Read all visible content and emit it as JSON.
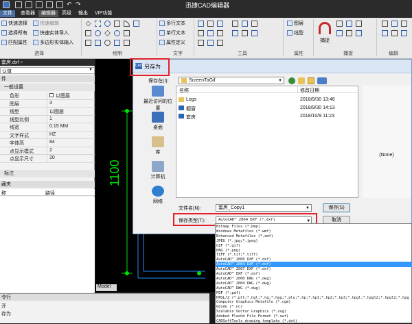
{
  "app": {
    "title": "迅捷CAD编辑器",
    "menu": [
      "文件",
      "查看器",
      "编辑器",
      "高级",
      "输出",
      "VIP功能"
    ],
    "active_menu": "编辑器",
    "accent": "#4a6fa5"
  },
  "ribbon": {
    "select_group": {
      "items": [
        "快速选择",
        "选择所有",
        "匹配属性",
        "快速编辑",
        "快速实体导入",
        "多边形实体输入"
      ],
      "label": "选择"
    },
    "draw_group": {
      "label": "绘制"
    },
    "text_group": {
      "items": [
        "多行文本",
        "单行文本",
        "属性定义"
      ],
      "label": "文字"
    },
    "tools_group": {
      "label": "工具"
    },
    "props_group": {
      "items": [
        "图层",
        "线型"
      ],
      "label": "属性"
    },
    "snap_group": {
      "items": [
        "捕捉"
      ],
      "label": "捕捉"
    },
    "edit_group": {
      "label": "编辑"
    }
  },
  "left_panel": {
    "doc_tab": "套房.dxf",
    "default_combo": "认值",
    "header": "件",
    "section": "一般设置",
    "properties": [
      {
        "key": "色彩",
        "value": "以图层"
      },
      {
        "key": "图层",
        "value": "3"
      },
      {
        "key": "线型",
        "value": "以图层"
      },
      {
        "key": "线型比例",
        "value": "1"
      },
      {
        "key": "线宽",
        "value": "0.15 MM"
      },
      {
        "key": "文字样式",
        "value": "HZ"
      },
      {
        "key": "字体高",
        "value": "84"
      },
      {
        "key": "点显示模式",
        "value": "2"
      },
      {
        "key": "点显示尺寸",
        "value": "20"
      }
    ],
    "dim_label": "标注",
    "favorites_header": "藏夹",
    "fav_col_name": "称",
    "fav_col_path": "路径",
    "cmd_header": "令行",
    "cmd_line1": "开",
    "cmd_line2": "存为"
  },
  "canvas": {
    "dimension_text": "1100",
    "model_tab": "Model"
  },
  "dialog": {
    "title": "另存为",
    "save_in_label": "保存在(I):",
    "save_in_value": "ScreenToGif",
    "places": [
      "最近访问的位置",
      "桌面",
      "库",
      "计算机",
      "网络"
    ],
    "columns": {
      "name": "名称",
      "date": "修改日期"
    },
    "files": [
      {
        "name": "Logs",
        "date": "2018/9/30 13:46"
      },
      {
        "name": "橱窗",
        "date": "2018/9/30 14:13"
      },
      {
        "name": "套房",
        "date": "2018/10/9 11:23"
      }
    ],
    "preview_text": "(None)",
    "filename_label": "文件名(N):",
    "filename_value": "套房_Copy1",
    "filetype_label": "保存类型(T):",
    "filetype_value": "AutoCAD™ 2004 DXF (*.dxf)",
    "save_button": "保存(S)",
    "cancel_button": "取消"
  },
  "filetypes": [
    "Bitmap Files (*.bmp)",
    "Windows Metafiles (*.wmf)",
    "Enhanced Metafiles (*.emf)",
    "JPEG (*.jpg;*.jpeg)",
    "GIF (*.gif)",
    "PNG (*.png)",
    "TIFF (*.tif;*.tiff)",
    "AutoCAD™ 2000 DXF (*.dxf)",
    "AutoCAD™ 2004 DXF (*.dxf)",
    "AutoCAD™ 2007 DXF (*.dxf)",
    "AutoCAD™ DXF (*.dxf)",
    "AutoCAD™ 2000 DWG (*.dwg)",
    "AutoCAD™ 2004 DWG (*.dwg)",
    "AutoCAD™ DWG (*.dwg)",
    "PDF (*.pdf)",
    "HPGL/2 (*.plt;*.hgl;*.hg;*.hpg;*.plo;*.hp;*.hp1;*.hp2;*.hp3;*.hpgl;*.hpgl2;*.hpgl2;*.hpg",
    "Computer Graphics Metafile (*.cgm)",
    "GCode (*.nc)",
    "Scalable Vector Graphics (*.svg)",
    "Adobe® Flash® File Format (*.swf)",
    "CADSoftTools drawing template (*.dxt)"
  ],
  "selected_filetype_index": 8
}
